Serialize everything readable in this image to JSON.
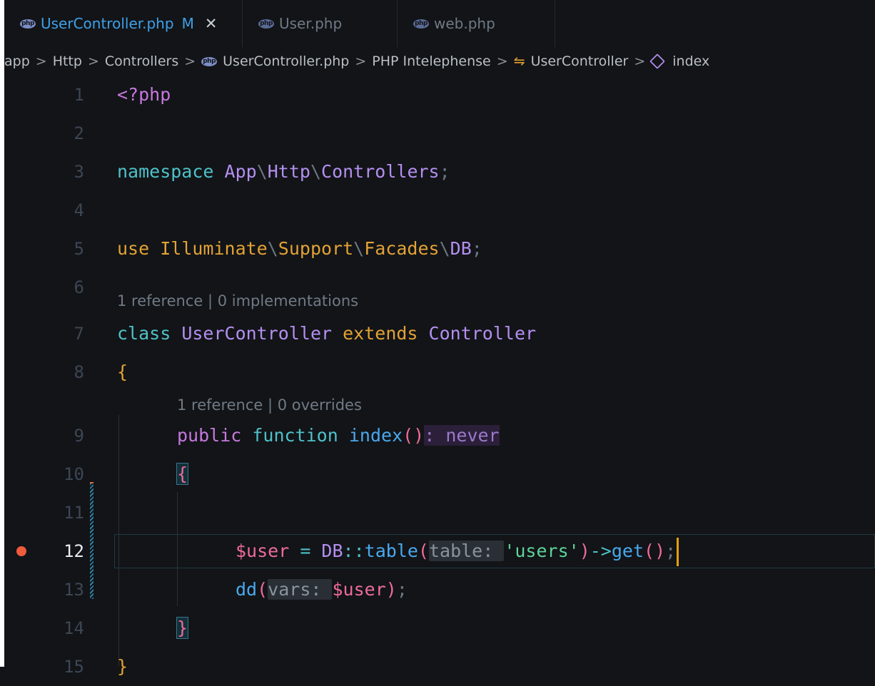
{
  "tabs": [
    {
      "icon": "php-file-icon",
      "name": "UserController.php",
      "badge": "M",
      "close": "✕",
      "active": true
    },
    {
      "icon": "php-file-icon",
      "name": "User.php",
      "active": false
    },
    {
      "icon": "php-file-icon",
      "name": "web.php",
      "active": false
    }
  ],
  "php_logo": "php",
  "breadcrumb": {
    "items": [
      "app",
      "Http",
      "Controllers",
      "UserController.php",
      "PHP Intelephense",
      "UserController",
      "index"
    ],
    "separator": ">"
  },
  "code_lens": {
    "class": "1 reference | 0 implementations",
    "method": "1 reference | 0 overrides"
  },
  "line_numbers": [
    "1",
    "2",
    "3",
    "4",
    "5",
    "6",
    "7",
    "8",
    "9",
    "10",
    "11",
    "12",
    "13",
    "14",
    "15"
  ],
  "code": {
    "l1": "<?php",
    "l3": {
      "kw": "namespace",
      "a": "App",
      "s1": "\\",
      "b": "Http",
      "s2": "\\",
      "c": "Controllers",
      "semi": ";"
    },
    "l5": {
      "kw": "use",
      "a": "Illuminate",
      "s1": "\\",
      "b": "Support",
      "s2": "\\",
      "c": "Facades",
      "s3": "\\",
      "d": "DB",
      "semi": ";"
    },
    "l7": {
      "kw": "class",
      "name": "UserController",
      "ext": "extends",
      "parent": "Controller"
    },
    "l8": "{",
    "l9": {
      "kw1": "public",
      "kw2": "function",
      "name": "index",
      "parens": "()",
      "ret": ": never"
    },
    "l10": "{",
    "l12": {
      "var": "$user",
      "eq": " = ",
      "cls": "DB",
      "op": "::",
      "fn": "table",
      "open": "(",
      "hint": "table: ",
      "str": "'users'",
      "close": ")",
      "arrow": "->",
      "get": "get",
      "gparens": "()",
      "semi": ";"
    },
    "l13": {
      "fn": "dd",
      "open": "(",
      "hint": "vars: ",
      "var": "$user",
      "close": ")",
      "semi": ";"
    },
    "l14": "}",
    "l15": "}"
  },
  "colors": {
    "background": "#121417",
    "accent": "#3fa0e8",
    "breakpoint": "#f05a3d",
    "cursor": "#e5a00d"
  }
}
